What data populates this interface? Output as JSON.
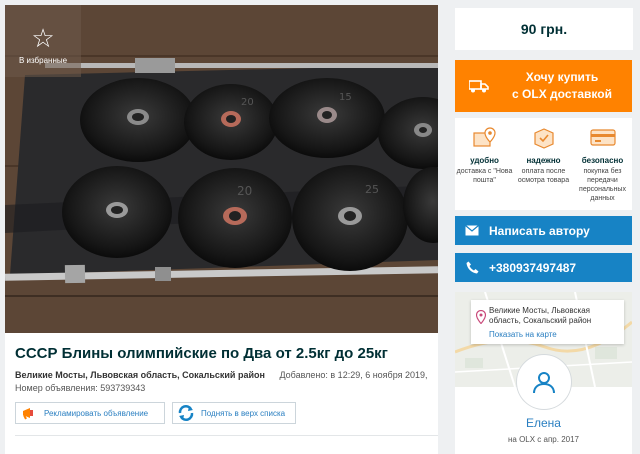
{
  "favorite": {
    "label": "В избранные",
    "icon": "star-outline-icon"
  },
  "ad": {
    "title": "СССР Блины олимпийские по Два от 2.5кг до 25кг",
    "location": "Великие Мосты, Львовская область, Сокальский район",
    "added": "Добавлено: в 12:29, 6 ноября 2019,",
    "number": "Номер объявления: 593739343"
  },
  "promo": {
    "advertise_label": "Рекламировать объявление",
    "advertise_icon": "megaphone-icon",
    "raise_label": "Поднять в верх списка",
    "raise_icon": "refresh-arrows-icon"
  },
  "sidebar": {
    "price": "90 грн.",
    "buy_button": {
      "line1": "Хочу купить",
      "line2": "с OLX доставкой",
      "icon": "truck-icon"
    },
    "benefits": [
      {
        "title": "удобно",
        "desc": "доставка с \"Нова пошта\"",
        "icon": "location-box-icon"
      },
      {
        "title": "надежно",
        "desc": "оплата после осмотра товара",
        "icon": "box-check-icon"
      },
      {
        "title": "безопасно",
        "desc": "покупка без передачи персональных данных",
        "icon": "card-icon"
      }
    ],
    "message_button": "Написать автору",
    "phone_button": "+380937497487",
    "map": {
      "address": "Великие Мосты, Львовская область, Сокальский район",
      "link": "Показать на карте"
    },
    "user": {
      "name": "Елена",
      "since": "на OLX с апр. 2017"
    }
  },
  "colors": {
    "orange": "#ff8200",
    "blue": "#1783c5",
    "dark": "#002f34",
    "link": "#2a7fc1"
  }
}
